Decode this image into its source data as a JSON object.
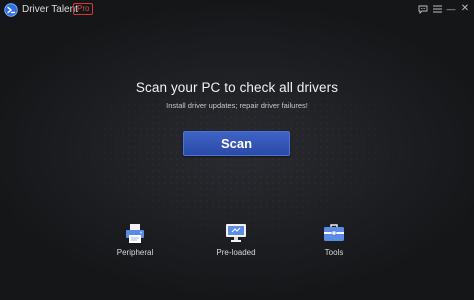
{
  "window": {
    "title": "Driver Talent",
    "badge": "Pro",
    "controls": {
      "feedback_icon": "chat-bubble-icon",
      "menu_icon": "hamburger-menu-icon",
      "minimize_glyph": "—",
      "close_glyph": "✕"
    }
  },
  "hero": {
    "headline": "Scan your PC to check all drivers",
    "subline": "Install driver updates; repair driver failures!",
    "scan_label": "Scan"
  },
  "tools": [
    {
      "label": "Peripheral",
      "icon": "printer-icon"
    },
    {
      "label": "Pre-loaded",
      "icon": "monitor-icon"
    },
    {
      "label": "Tools",
      "icon": "toolbox-icon"
    }
  ],
  "colors": {
    "accent": "#3557bd",
    "badge_red": "#d23a3a",
    "background": "#1b1c1f"
  }
}
